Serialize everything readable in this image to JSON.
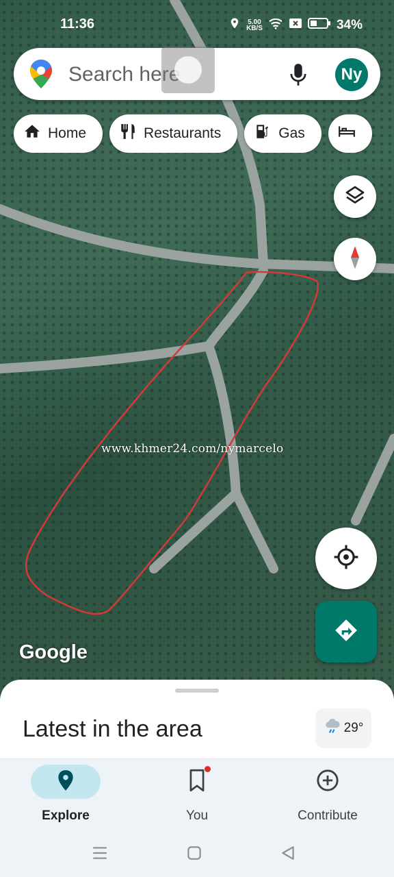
{
  "status_bar": {
    "time": "11:36",
    "net_speed_value": "5.00",
    "net_speed_unit": "KB/S",
    "battery": "34%"
  },
  "search": {
    "placeholder": "Search here"
  },
  "account": {
    "initials": "Ny"
  },
  "chips": [
    {
      "label": "Home",
      "icon": "home-icon"
    },
    {
      "label": "Restaurants",
      "icon": "fork-knife-icon"
    },
    {
      "label": "Gas",
      "icon": "gas-station-icon"
    },
    {
      "label": "",
      "icon": "bed-icon"
    }
  ],
  "map": {
    "watermark": "www.khmer24.com/nymarcelo",
    "attribution": "Google",
    "boundary_color": "#d23a3a"
  },
  "sheet": {
    "title": "Latest in the area",
    "temperature": "29°"
  },
  "nav": {
    "items": [
      {
        "label": "Explore",
        "icon": "location-pin-icon",
        "active": true
      },
      {
        "label": "You",
        "icon": "bookmark-icon",
        "active": false
      },
      {
        "label": "Contribute",
        "icon": "plus-circle-icon",
        "active": false
      }
    ]
  },
  "colors": {
    "accent": "#00796b",
    "nav_active": "#c2e7ef"
  }
}
